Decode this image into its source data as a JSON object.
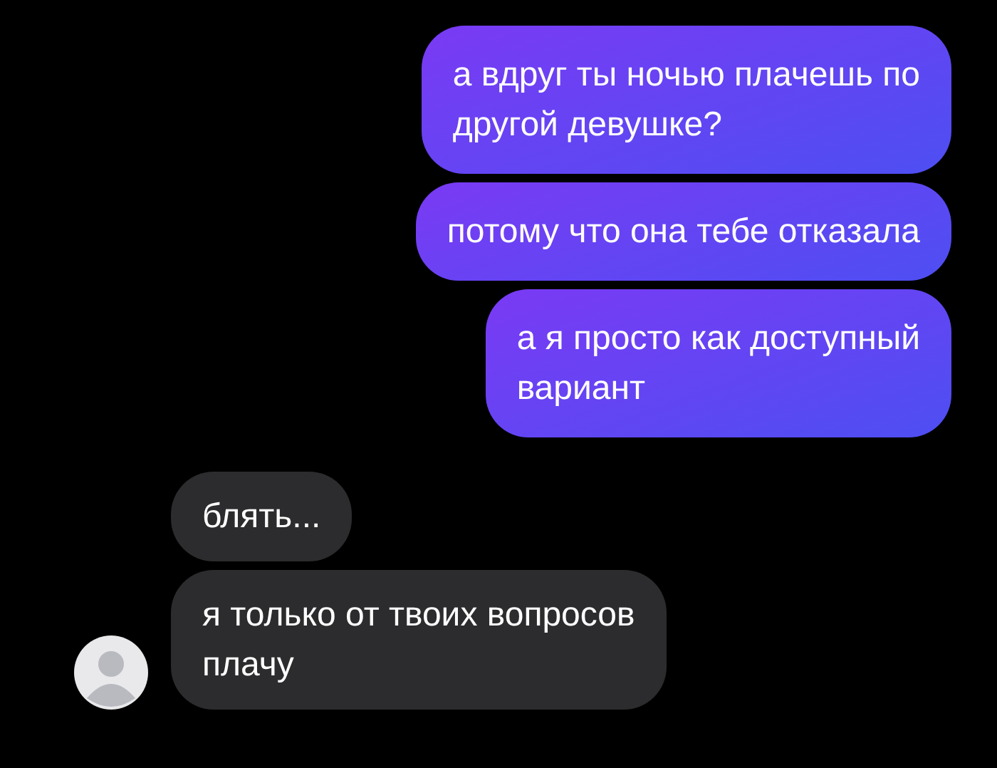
{
  "messages": [
    {
      "kind": "outgoing",
      "text": "а вдруг ты ночью плачешь по\nдругой девушке?",
      "show_avatar": false
    },
    {
      "kind": "outgoing",
      "text": "потому что она тебе отказала",
      "show_avatar": false
    },
    {
      "kind": "outgoing",
      "text": "а я просто как доступный\nвариант",
      "show_avatar": false
    },
    {
      "kind": "incoming",
      "text": "блять...",
      "show_avatar": false
    },
    {
      "kind": "incoming",
      "text": "я только от твоих вопросов\nплачу",
      "show_avatar": true
    }
  ]
}
